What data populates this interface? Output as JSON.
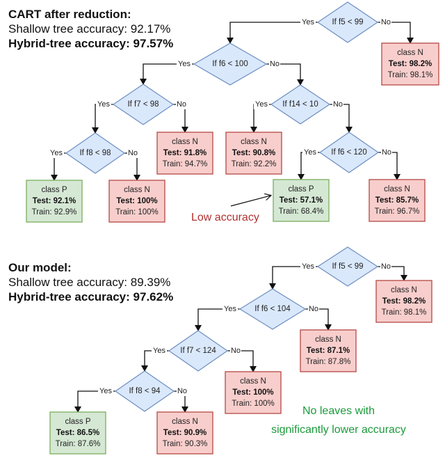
{
  "colors": {
    "decision_fill": "#dae8fc",
    "decision_stroke": "#6c8ebf",
    "class_n_fill": "#f8cecc",
    "class_n_stroke": "#b85450",
    "class_p_fill": "#d5e8d4",
    "class_p_stroke": "#82b366",
    "low_accuracy_text": "#b03030",
    "no_leaves_text": "#1a9a3a"
  },
  "labels": {
    "yes": "Yes",
    "no": "No"
  },
  "cart": {
    "title": "CART after reduction:",
    "shallow_label": "Shallow tree accuracy: ",
    "shallow_value": "92.17%",
    "hybrid_label": "Hybrid-tree accuracy: ",
    "hybrid_value": "97.57%",
    "annotation": "Low accuracy",
    "decisions": [
      {
        "id": "d1",
        "text": "If f5 < 99"
      },
      {
        "id": "d2",
        "text": "If f6 < 100"
      },
      {
        "id": "d3",
        "text": "If f7 < 98"
      },
      {
        "id": "d4",
        "text": "If f8 < 98"
      },
      {
        "id": "d5",
        "text": "If f14 < 10"
      },
      {
        "id": "d6",
        "text": "If f6 < 120"
      }
    ],
    "leaves": [
      {
        "id": "l1",
        "cls": "class N",
        "test": "Test: 98.2%",
        "train": "Train: 98.1%"
      },
      {
        "id": "l2",
        "cls": "class N",
        "test": "Test: 91.8%",
        "train": "Train: 94.7%"
      },
      {
        "id": "l3",
        "cls": "class P",
        "test": "Test: 92.1%",
        "train": "Train: 92.9%"
      },
      {
        "id": "l4",
        "cls": "class N",
        "test": "Test: 100%",
        "train": "Train: 100%"
      },
      {
        "id": "l5",
        "cls": "class N",
        "test": "Test: 90.8%",
        "train": "Train: 92.2%"
      },
      {
        "id": "l6",
        "cls": "class P",
        "test": "Test: 57.1%",
        "train": "Train: 68.4%"
      },
      {
        "id": "l7",
        "cls": "class N",
        "test": "Test: 85.7%",
        "train": "Train: 96.7%"
      }
    ]
  },
  "ours": {
    "title": "Our model:",
    "shallow_label": "Shallow tree accuracy: ",
    "shallow_value": "89.39%",
    "hybrid_label": "Hybrid-tree accuracy: ",
    "hybrid_value": "97.62%",
    "annotation_line1": "No leaves with",
    "annotation_line2": "significantly lower accuracy",
    "decisions": [
      {
        "id": "e1",
        "text": "If f5 < 99"
      },
      {
        "id": "e2",
        "text": "If f6 < 104"
      },
      {
        "id": "e3",
        "text": "If f7 < 124"
      },
      {
        "id": "e4",
        "text": "If f8 < 94"
      }
    ],
    "leaves": [
      {
        "id": "m1",
        "cls": "class N",
        "test": "Test: 98.2%",
        "train": "Train: 98.1%"
      },
      {
        "id": "m2",
        "cls": "class N",
        "test": "Test: 87.1%",
        "train": "Train: 87.8%"
      },
      {
        "id": "m3",
        "cls": "class N",
        "test": "Test: 100%",
        "train": "Train: 100%"
      },
      {
        "id": "m4",
        "cls": "class P",
        "test": "Test: 86.5%",
        "train": "Train: 87.6%"
      },
      {
        "id": "m5",
        "cls": "class N",
        "test": "Test: 90.9%",
        "train": "Train: 90.3%"
      }
    ]
  }
}
